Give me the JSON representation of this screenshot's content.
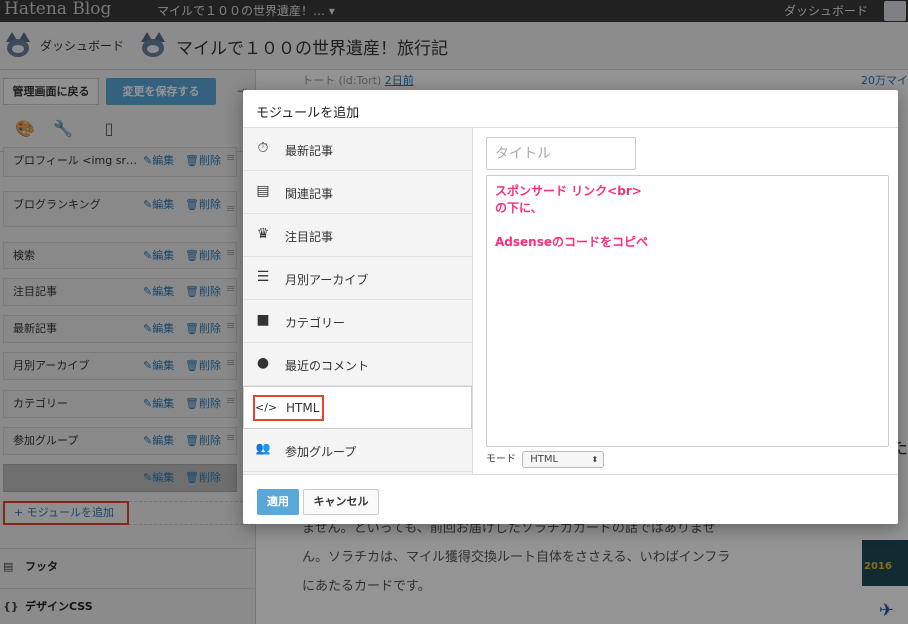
{
  "topbar": {
    "logo": "Hatena Blog",
    "blog_selector": "マイルで１００の世界遺産！… ▾",
    "dashboard": "ダッシュボード"
  },
  "header": {
    "dashboard_label": "ダッシュボード",
    "blog_title": "マイルで１００の世界遺産！旅行記"
  },
  "sidebar": {
    "back_button": "管理画面に戻る",
    "save_button": "変更を保存する",
    "collapse_icon": "⇥",
    "tabs": [
      {
        "icon": "palette-icon",
        "glyph": "🎨"
      },
      {
        "icon": "wrench-icon",
        "glyph": "🔧"
      },
      {
        "icon": "phone-icon",
        "glyph": "▯"
      }
    ],
    "modules": [
      {
        "name": "プロフィール <img sr…"
      },
      {
        "name": "ブログランキング"
      },
      {
        "name": "検索"
      },
      {
        "name": "注目記事"
      },
      {
        "name": "最新記事"
      },
      {
        "name": "月別アーカイブ"
      },
      {
        "name": "カテゴリー"
      },
      {
        "name": "参加グループ"
      },
      {
        "name": ""
      }
    ],
    "edit_label": "✎編集",
    "delete_label": "🗑削除",
    "drag_handle": "≡",
    "add_module": "+ モジュールを追加",
    "footer_section": "フッタ",
    "design_css_section": "デザインCSS",
    "footer_icon": "▤",
    "css_icon": "{}"
  },
  "article": {
    "meta_prefix": "トート (id:Tort) ",
    "meta_link": "2日前",
    "right_link": "20万マイ",
    "right_heading": "た",
    "right_image_text": "2016",
    "right_plane": "✈",
    "paragraphs": [
      "ません。といっても、前回お届けしたソラチカカードの話ではありませ",
      "ん。ソラチカは、マイル獲得交換ルート自体をささえる、いわばインフラ",
      "にあたるカードです。"
    ]
  },
  "modal": {
    "title": "モジュールを追加",
    "items": [
      {
        "label": "最新記事",
        "icon": "stopwatch-icon",
        "glyph": "⏱"
      },
      {
        "label": "関連記事",
        "icon": "document-icon",
        "glyph": "▤"
      },
      {
        "label": "注目記事",
        "icon": "crown-icon",
        "glyph": "♛"
      },
      {
        "label": "月別アーカイブ",
        "icon": "list-icon",
        "glyph": "☰"
      },
      {
        "label": "カテゴリー",
        "icon": "folder-icon",
        "glyph": "■"
      },
      {
        "label": "最近のコメント",
        "icon": "comment-icon",
        "glyph": "●"
      },
      {
        "label": "HTML",
        "icon": "code-icon",
        "glyph": "</>"
      },
      {
        "label": "参加グループ",
        "icon": "group-icon",
        "glyph": "👥"
      }
    ],
    "title_placeholder": "タイトル",
    "code_lines": [
      "スポンサード リンク<br>",
      "の下に、",
      "",
      "Adsenseのコードをコピペ"
    ],
    "mode_label": "モード",
    "mode_value": "HTML",
    "apply_button": "適用",
    "cancel_button": "キャンセル"
  },
  "colors": {
    "accent": "#5aa7d9",
    "highlight_border": "#e24632",
    "annotation_text": "#ff2c7a"
  }
}
